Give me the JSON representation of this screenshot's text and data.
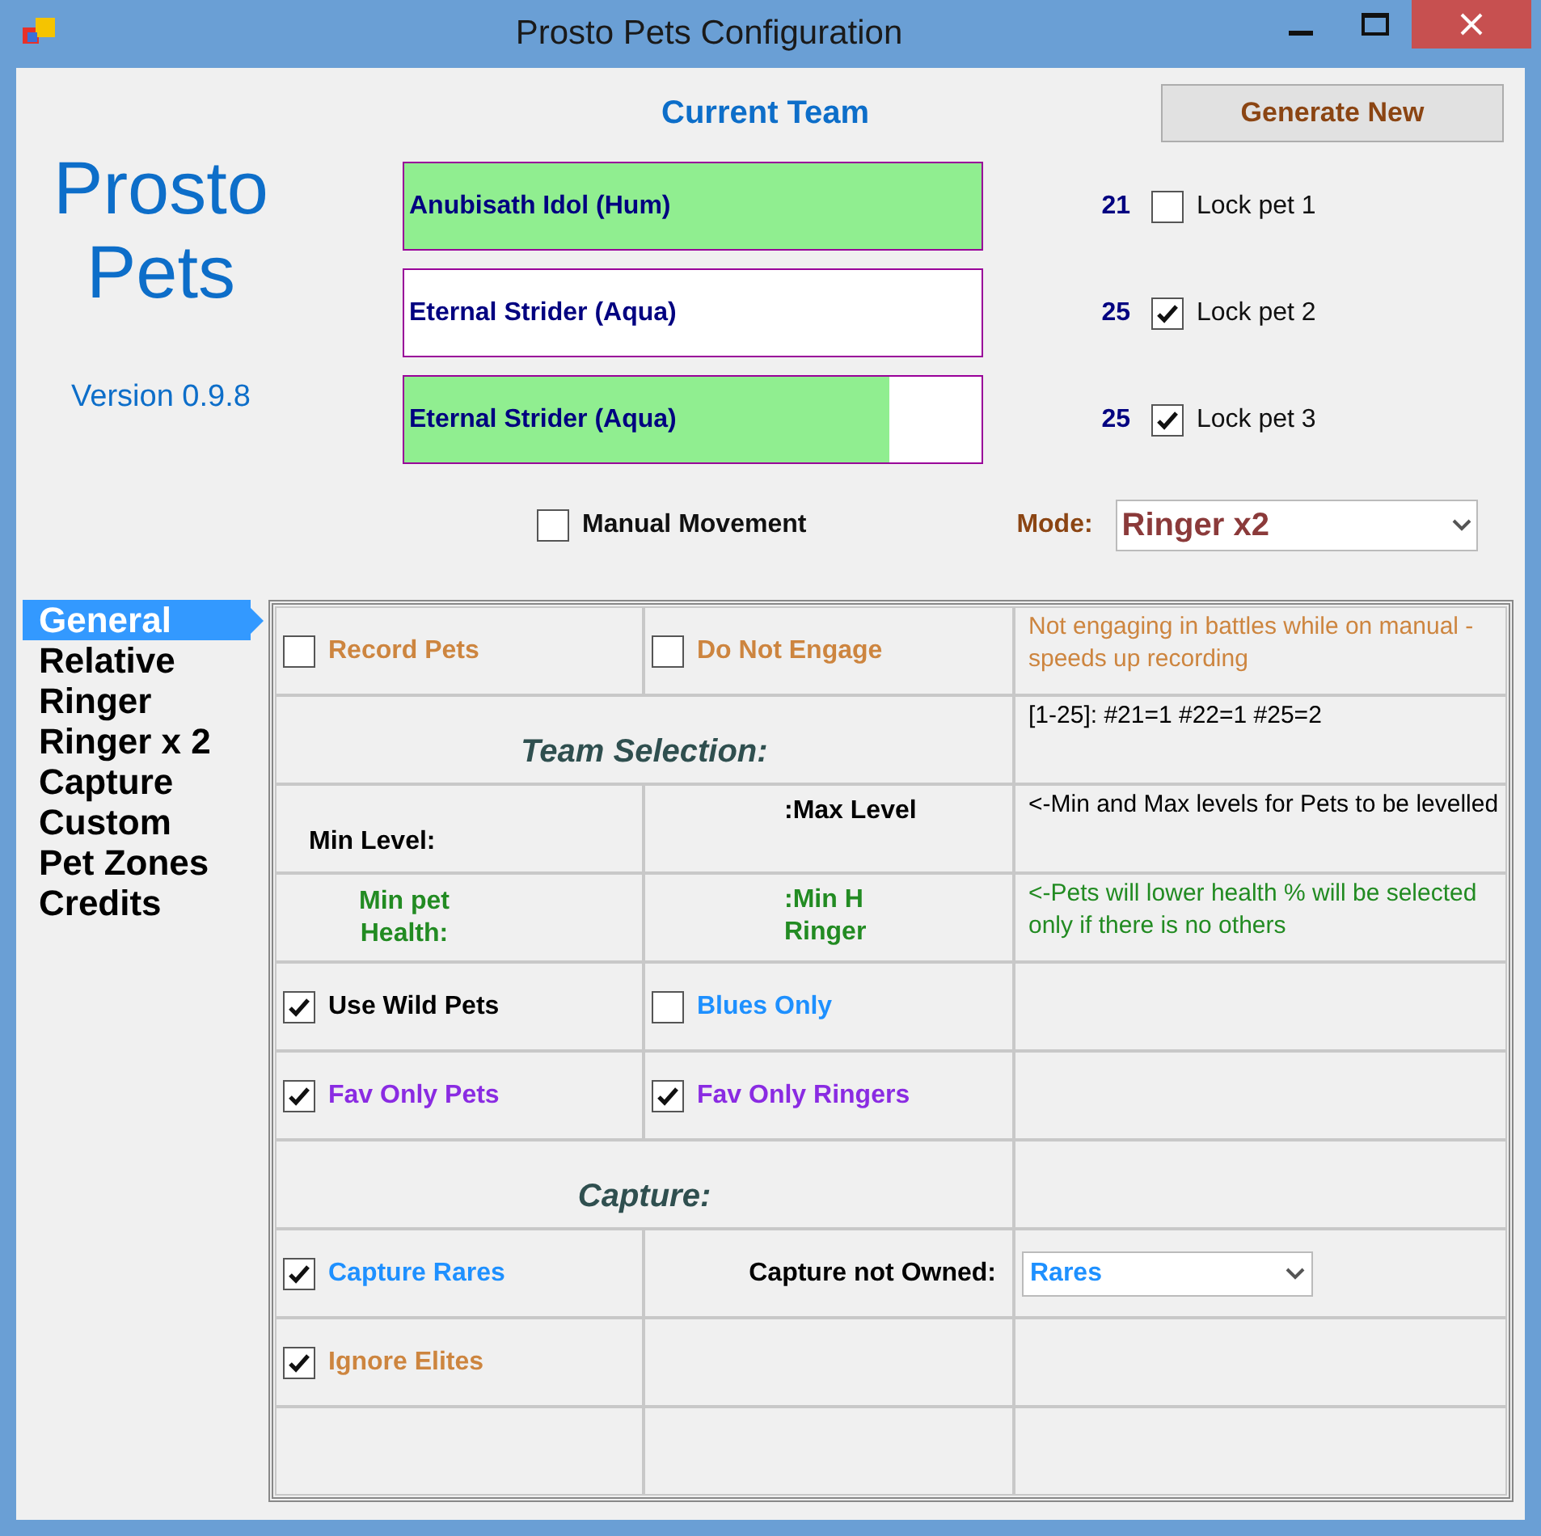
{
  "window": {
    "title": "Prosto Pets Configuration"
  },
  "logo": {
    "title": "Prosto Pets",
    "version": "Version 0.9.8"
  },
  "team": {
    "heading": "Current Team",
    "generate_button": "Generate New",
    "pets": [
      {
        "name": "Anubisath Idol (Hum)",
        "level": 1,
        "pet_level": "21",
        "lock_label": "Lock pet 1",
        "locked": false
      },
      {
        "name": "Eternal Strider (Aqua)",
        "level": 0,
        "pet_level": "25",
        "lock_label": "Lock pet 2",
        "locked": true
      },
      {
        "name": "Eternal Strider (Aqua)",
        "level": 0.84,
        "pet_level": "25",
        "lock_label": "Lock pet 3",
        "locked": true
      }
    ]
  },
  "manual_movement": {
    "label": "Manual Movement",
    "checked": false
  },
  "mode": {
    "label": "Mode:",
    "value": "Ringer x2"
  },
  "sidebar": {
    "items": [
      {
        "label": "General",
        "selected": true
      },
      {
        "label": "Relative",
        "selected": false
      },
      {
        "label": "Ringer",
        "selected": false
      },
      {
        "label": "Ringer x 2",
        "selected": false
      },
      {
        "label": "Capture",
        "selected": false
      },
      {
        "label": "Custom",
        "selected": false
      },
      {
        "label": "Pet Zones",
        "selected": false
      },
      {
        "label": "Credits",
        "selected": false
      }
    ]
  },
  "table": {
    "rows": [
      {
        "cells": [
          {
            "kind": "checkbox",
            "label": "Record Pets",
            "checked": false,
            "color": "#cd853f"
          },
          {
            "kind": "checkbox",
            "label": "Do Not Engage",
            "checked": false,
            "color": "#cd853f"
          },
          {
            "kind": "note",
            "text": "Not engaging in battles while on manual - speeds up recording",
            "color": "#cd853f"
          }
        ]
      },
      {
        "cells": [
          {
            "kind": "heading",
            "text": "Team Selection:",
            "colspan": 2
          },
          {
            "kind": "note",
            "text": "[1-25]: #21=1 #22=1 #25=2",
            "color": "#000000"
          }
        ]
      },
      {
        "cells": [
          {
            "kind": "label",
            "text": "Min Level:",
            "color": "#000000"
          },
          {
            "kind": "label",
            "text": ":Max Level",
            "color": "#000000"
          },
          {
            "kind": "note",
            "text": "<-Min and Max levels for Pets to be levelled",
            "color": "#000000"
          }
        ]
      },
      {
        "cells": [
          {
            "kind": "label",
            "text": "Min pet Health:",
            "color": "#228b22"
          },
          {
            "kind": "label",
            "text": ":Min H Ringer",
            "color": "#228b22"
          },
          {
            "kind": "note",
            "text": "<-Pets will lower health % will be selected only if there is no others",
            "color": "#228b22"
          }
        ]
      },
      {
        "cells": [
          {
            "kind": "checkbox",
            "label": "Use Wild Pets",
            "checked": true,
            "color": "#000000"
          },
          {
            "kind": "checkbox",
            "label": "Blues Only",
            "checked": false,
            "color": "#1e90ff"
          },
          {
            "kind": "empty"
          }
        ]
      },
      {
        "cells": [
          {
            "kind": "checkbox",
            "label": "Fav Only Pets",
            "checked": true,
            "color": "#8a2be2"
          },
          {
            "kind": "checkbox",
            "label": "Fav Only Ringers",
            "checked": true,
            "color": "#8a2be2"
          },
          {
            "kind": "empty"
          }
        ]
      },
      {
        "cells": [
          {
            "kind": "heading",
            "text": "Capture:",
            "colspan": 2
          },
          {
            "kind": "empty"
          }
        ]
      },
      {
        "cells": [
          {
            "kind": "checkbox",
            "label": "Capture Rares",
            "checked": true,
            "color": "#1e90ff"
          },
          {
            "kind": "label",
            "text": "Capture not Owned:",
            "color": "#000000"
          },
          {
            "kind": "select",
            "value": "Rares",
            "color": "#1e90ff"
          }
        ]
      },
      {
        "cells": [
          {
            "kind": "checkbox",
            "label": "Ignore Elites",
            "checked": true,
            "color": "#cd853f"
          },
          {
            "kind": "empty"
          },
          {
            "kind": "empty"
          }
        ]
      },
      {
        "cells": [
          {
            "kind": "empty"
          },
          {
            "kind": "empty"
          },
          {
            "kind": "empty"
          }
        ]
      }
    ]
  }
}
